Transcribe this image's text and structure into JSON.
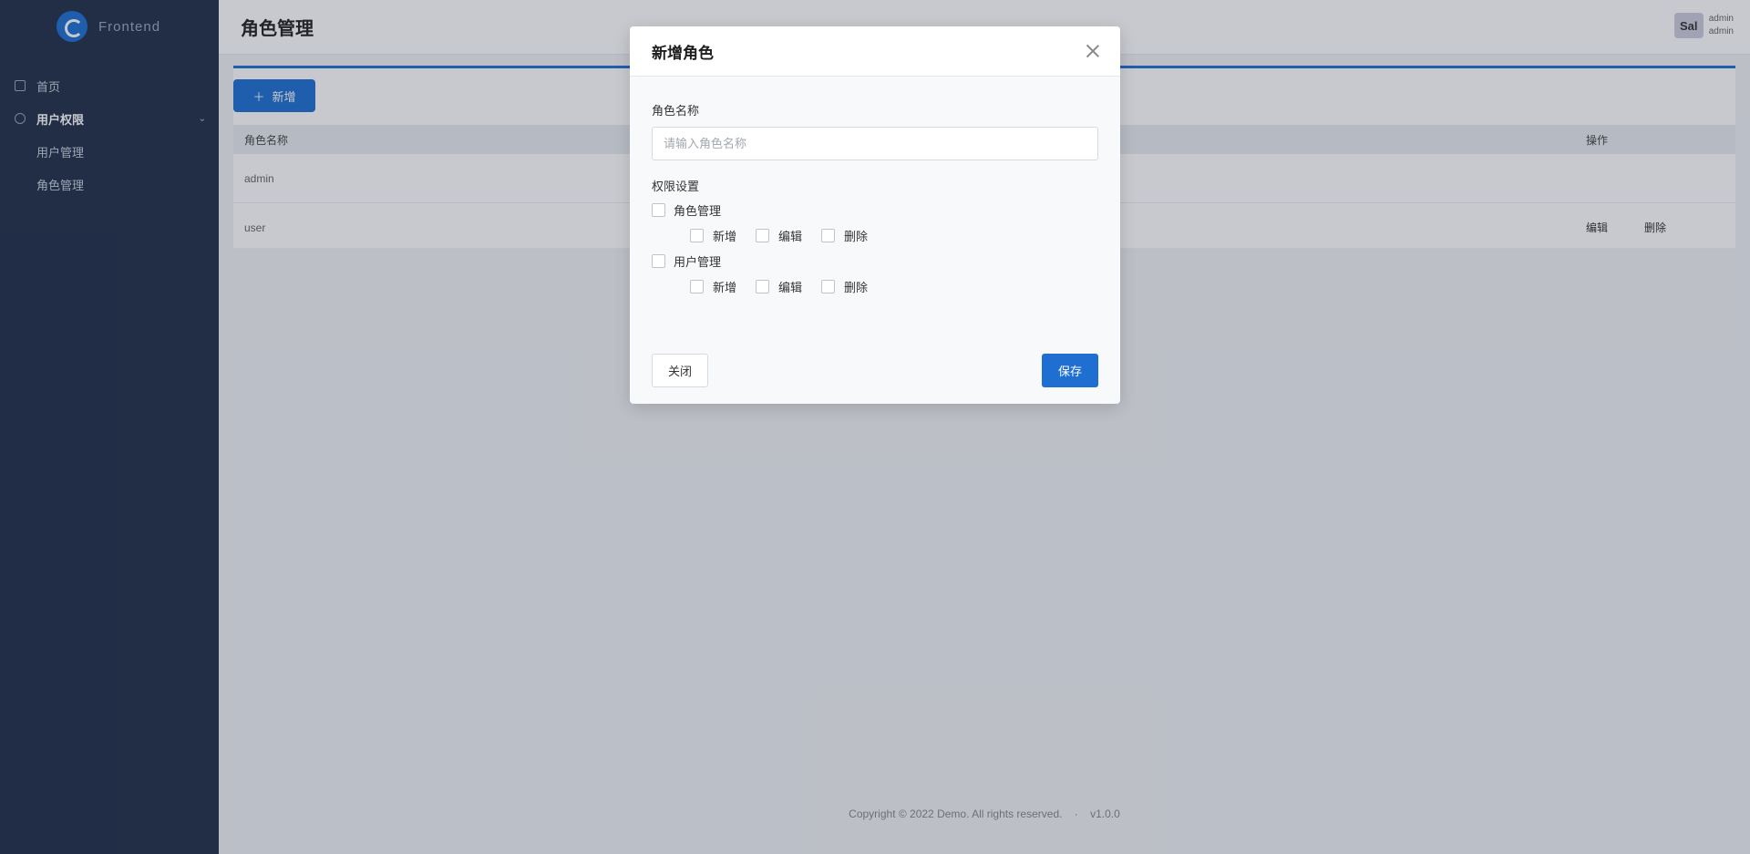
{
  "sidebar": {
    "logo_text": "Frontend",
    "items": [
      {
        "label": "首页"
      },
      {
        "label": "用户权限"
      },
      {
        "label": "用户管理"
      },
      {
        "label": "角色管理"
      }
    ]
  },
  "header": {
    "page_title": "角色管理",
    "user_avatar": "Sal",
    "user_line1": "admin",
    "user_line2": "admin"
  },
  "toolbar": {
    "add_label": "新增"
  },
  "table": {
    "columns": [
      "角色名称",
      "操作"
    ],
    "rows": [
      {
        "name": "admin",
        "actions": []
      },
      {
        "name": "user",
        "actions": [
          "编辑",
          "删除"
        ]
      }
    ]
  },
  "footer": {
    "copyright": "Copyright © 2022 Demo. All rights reserved.",
    "version": "v1.0.0"
  },
  "modal": {
    "title": "新增角色",
    "role_name_label": "角色名称",
    "role_name_placeholder": "请输入角色名称",
    "role_name_value": "",
    "permissions_label": "权限设置",
    "groups": [
      {
        "label": "角色管理",
        "checked": false,
        "options": [
          {
            "label": "新增",
            "checked": false
          },
          {
            "label": "编辑",
            "checked": false
          },
          {
            "label": "删除",
            "checked": false
          }
        ]
      },
      {
        "label": "用户管理",
        "checked": false,
        "options": [
          {
            "label": "新增",
            "checked": false
          },
          {
            "label": "编辑",
            "checked": false
          },
          {
            "label": "删除",
            "checked": false
          }
        ]
      }
    ],
    "close_label": "关闭",
    "save_label": "保存"
  },
  "colors": {
    "primary": "#1f6fd3",
    "sidebar_bg": "#22304a"
  }
}
